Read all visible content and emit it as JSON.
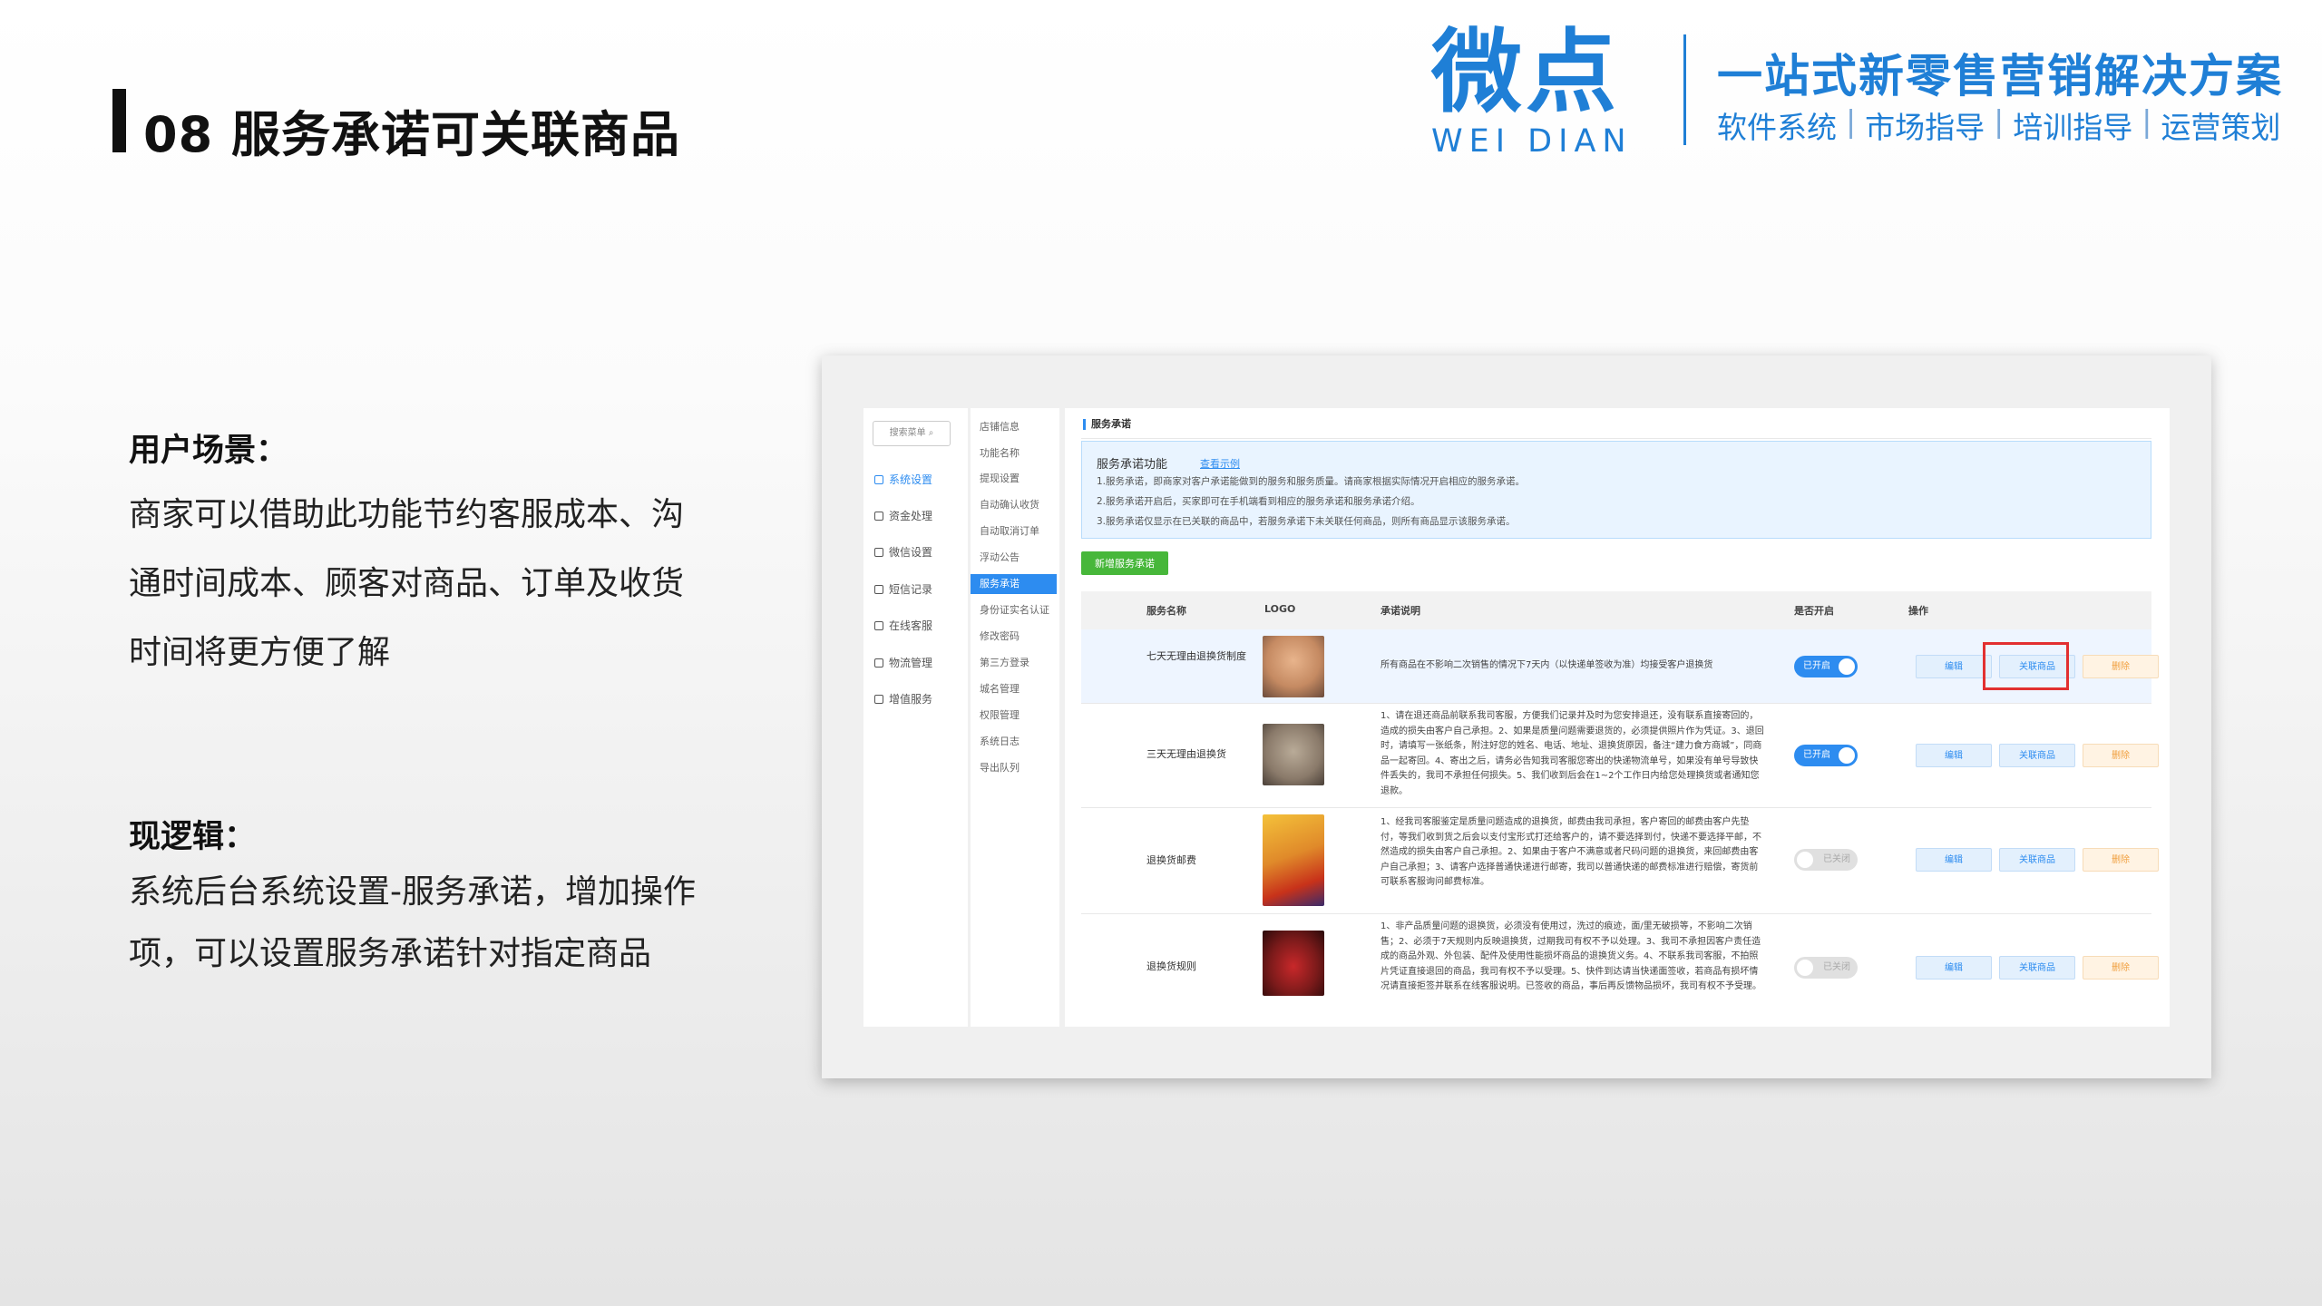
{
  "slide": {
    "title": "08 服务承诺可关联商品",
    "logo_cn": "微点",
    "logo_en": "WEI DIAN",
    "tagline": "一站式新零售营销解决方案",
    "services": [
      "软件系统",
      "市场指导",
      "培训指导",
      "运营策划"
    ]
  },
  "left": {
    "scene_label": "用户场景：",
    "scene_text": "商家可以借助此功能节约客服成本、沟通时间成本、顾客对商品、订单及收货时间将更方便了解",
    "logic_label": "现逻辑：",
    "logic_text": "系统后台系统设置-服务承诺，增加操作项，可以设置服务承诺针对指定商品"
  },
  "admin": {
    "search_placeholder": "搜索菜单 ⌕",
    "nav1": [
      {
        "label": "系统设置",
        "icon": "gear-icon",
        "active": true
      },
      {
        "label": "资金处理",
        "icon": "money-icon",
        "active": false
      },
      {
        "label": "微信设置",
        "icon": "wechat-icon",
        "active": false
      },
      {
        "label": "短信记录",
        "icon": "sms-icon",
        "active": false
      },
      {
        "label": "在线客服",
        "icon": "service-icon",
        "active": false
      },
      {
        "label": "物流管理",
        "icon": "truck-icon",
        "active": false
      },
      {
        "label": "增值服务",
        "icon": "plus-icon",
        "active": false
      }
    ],
    "nav2": [
      "店铺信息",
      "功能名称",
      "提现设置",
      "自动确认收货",
      "自动取消订单",
      "浮动公告",
      "服务承诺",
      "身份证实名认证",
      "修改密码",
      "第三方登录",
      "城名管理",
      "权限管理",
      "系统日志",
      "导出队列"
    ],
    "nav2_active_index": 6,
    "page_title": "服务承诺",
    "info": {
      "heading": "服务承诺功能",
      "link": "查看示例",
      "lines": [
        "1.服务承诺，即商家对客户承诺能做到的服务和服务质量。请商家根据实际情况开启相应的服务承诺。",
        "2.服务承诺开启后，买家即可在手机端看到相应的服务承诺和服务承诺介绍。",
        "3.服务承诺仅显示在已关联的商品中，若服务承诺下未关联任何商品，则所有商品显示该服务承诺。"
      ]
    },
    "add_button": "新增服务承诺",
    "columns": [
      "服务名称",
      "LOGO",
      "承诺说明",
      "是否开启",
      "操作"
    ],
    "rows": [
      {
        "name": "七天无理由退换货制度",
        "desc": "所有商品在不影响二次销售的情况下7天内（以快递单签收为准）均接受客户退换货",
        "enabled": true,
        "toggle_label": "已开启",
        "logo_color": "#c58a62"
      },
      {
        "name": "三天无理由退换货",
        "desc": "1、请在退还商品前联系我司客服，方便我们记录并及时为您安排退还，没有联系直接寄回的，造成的损失由客户自己承担。2、如果是质量问题需要退货的，必须提供照片作为凭证。3、退回时，请填写一张纸条，附注好您的姓名、电话、地址、退换货原因，备注“建力食方商城”，同商品一起寄回。4、寄出之后，请务必告知我司客服您寄出的快递物流单号，如果没有单号导致快件丢失的，我司不承担任何损失。5、我们收到后会在1~2个工作日内给您处理换货或者通知您退款。",
        "enabled": true,
        "toggle_label": "已开启",
        "logo_color": "#8a7a6a"
      },
      {
        "name": "退换货邮费",
        "desc": "1、经我司客服鉴定是质量问题造成的退换货，邮费由我司承担，客户寄回的邮费由客户先垫付，等我们收到货之后会以支付宝形式打还给客户的，请不要选择到付，快递不要选择平邮，不然造成的损失由客户自己承担。2、如果由于客户不满意或者尺码问题的退换货，来回邮费由客户自己承担；3、请客户选择普通快递进行邮寄，我司以普通快递的邮费标准进行赔偿，寄货前可联系客服询问邮费标准。",
        "enabled": false,
        "toggle_label": "已关闭",
        "logo_color": "#e08a2a"
      },
      {
        "name": "退换货规则",
        "desc": "1、非产品质量问题的退换货，必须没有使用过，洗过的痕迹，面/里无破损等，不影响二次销售；2、必须于7天规则内反映退换货，过期我司有权不予以处理。3、我司不承担因客户责任造成的商品外观、外包装、配件及使用性能损坏商品的退换货义务。4、不联系我司客服，不拍照片凭证直接退回的商品，我司有权不予以受理。5、快件到达请当快递面签收，若商品有损坏情况请直接拒签并联系在线客服说明。已签收的商品，事后再反馈物品损坏，我司有权不予受理。",
        "enabled": false,
        "toggle_label": "已关闭",
        "logo_color": "#7a1a1a"
      }
    ],
    "op_edit": "编辑",
    "op_link": "关联商品",
    "op_delete": "删除"
  },
  "colors": {
    "brand": "#1f7fd6",
    "admin_primary": "#2d8cf0",
    "add_button": "#47b73a",
    "highlight": "#e23030"
  }
}
